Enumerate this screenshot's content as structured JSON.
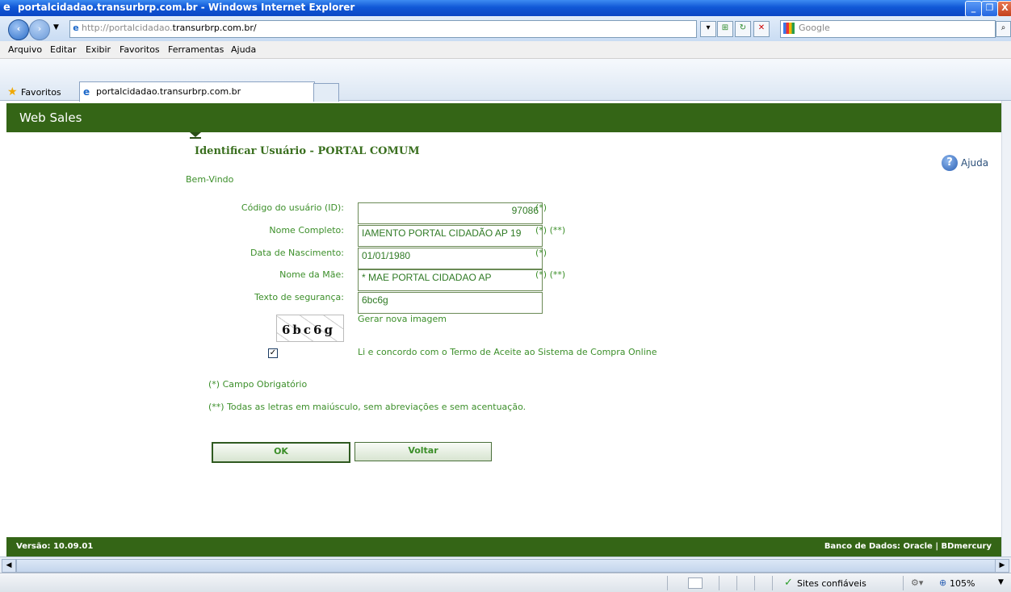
{
  "window": {
    "title": "portalcidadao.transurbrp.com.br - Windows Internet Explorer",
    "minimize": "_",
    "maximize": "❐",
    "close": "X"
  },
  "address": {
    "url_prefix": "http://portalcidadao.",
    "url_domain": "transurbrp.com.br/",
    "search_placeholder": "Google"
  },
  "menu": [
    "Arquivo",
    "Editar",
    "Exibir",
    "Favoritos",
    "Ferramentas",
    "Ajuda"
  ],
  "favorites": {
    "label": "Favoritos",
    "tab_title": "portalcidadao.transurbrp.com.br"
  },
  "page": {
    "header": "Web Sales",
    "title": "Identificar Usuário - PORTAL COMUM",
    "welcome": "Bem-Vindo",
    "help": "Ajuda"
  },
  "form": {
    "fields": [
      {
        "label": "Código do usuário (ID):",
        "value": "97086",
        "note": "(*)"
      },
      {
        "label": "Nome Completo:",
        "value": "IAMENTO PORTAL CIDADÃO AP 19",
        "note": "(*) (**)"
      },
      {
        "label": "Data de Nascimento:",
        "value": "01/01/1980",
        "note": "(*)"
      },
      {
        "label": "Nome da Mãe:",
        "value": "*  MAE PORTAL CIDADAO AP",
        "note": "(*) (**)"
      },
      {
        "label": "Texto de segurança:",
        "value": "6bc6g",
        "note": ""
      }
    ],
    "captcha_text": "6bc6g",
    "new_image": "Gerar nova imagem",
    "terms_checked": true,
    "terms_check_glyph": "✓",
    "terms": "Li e concordo com o Termo de Aceite ao Sistema de Compra Online",
    "note_required": "(*) Campo Obrigatório",
    "note_uppercase": "(**) Todas as letras em maiúsculo, sem abreviações e sem acentuação.",
    "ok_label": "OK",
    "back_label": "Voltar"
  },
  "footer": {
    "version": "Versão: 10.09.01",
    "database": "Banco de Dados: Oracle | BDmercury"
  },
  "status": {
    "zone": "Sites confiáveis",
    "zoom": "105%"
  },
  "colors": {
    "header_green": "#346516",
    "text_green": "#3c8f2a"
  }
}
